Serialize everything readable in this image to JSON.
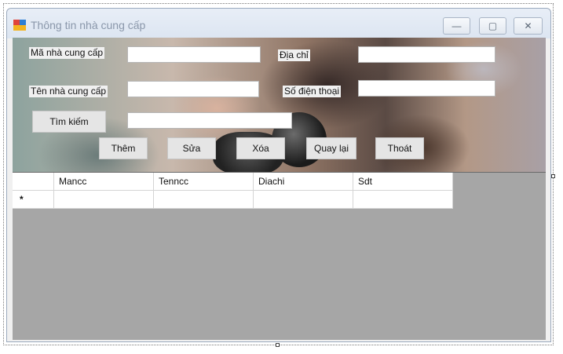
{
  "window": {
    "title": "Thông tin nhà cung cấp",
    "minimize_glyph": "—",
    "restore_glyph": "▢",
    "close_glyph": "✕"
  },
  "form": {
    "ma_ncc_label": "Mã nhà cung cấp",
    "ma_ncc_value": "",
    "dia_chi_label": "Địa chỉ",
    "dia_chi_value": "",
    "ten_ncc_label": "Tên nhà cung cấp",
    "ten_ncc_value": "",
    "sdt_label": "Số điện thoại",
    "sdt_value": "",
    "search_label": "Tìm kiếm",
    "search_value": ""
  },
  "buttons": {
    "them": "Thêm",
    "sua": "Sửa",
    "xoa": "Xóa",
    "quay_lai": "Quay lại",
    "thoat": "Thoát"
  },
  "grid": {
    "columns": [
      "Mancc",
      "Tenncc",
      "Diachi",
      "Sdt"
    ],
    "new_row_marker": "*",
    "new_row_cells": [
      "",
      "",
      "",
      ""
    ]
  },
  "icons": {
    "app": "app-form-icon",
    "minimize": "minimize-icon",
    "restore": "restore-icon",
    "close": "close-icon"
  },
  "colors": {
    "grid_background": "#a6a6a6",
    "title_text": "#8a97aa",
    "window_border": "#9aa9bd"
  }
}
